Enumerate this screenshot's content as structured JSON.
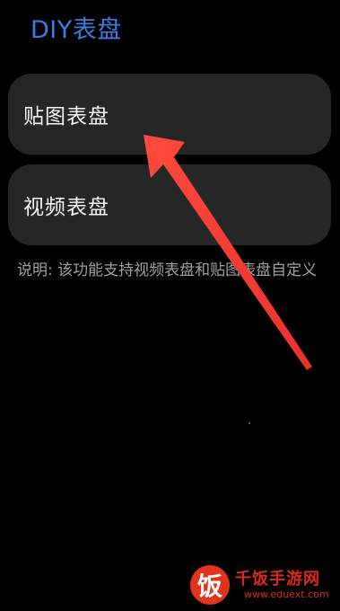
{
  "header": {
    "title": "DIY表盘"
  },
  "menu": {
    "items": [
      {
        "label": "贴图表盘"
      },
      {
        "label": "视频表盘"
      }
    ]
  },
  "note": {
    "text": "说明: 该功能支持视频表盘和贴图表盘自定义"
  },
  "annotation": {
    "arrow_color": "#ef3b3b"
  },
  "watermark": {
    "glyph": "饭",
    "name": "千饭手游网",
    "domain": "www.eduext.com",
    "color": "#e0341f"
  },
  "theme": {
    "accent": "#3a7fe0",
    "background": "#000000",
    "card": "#262626"
  }
}
